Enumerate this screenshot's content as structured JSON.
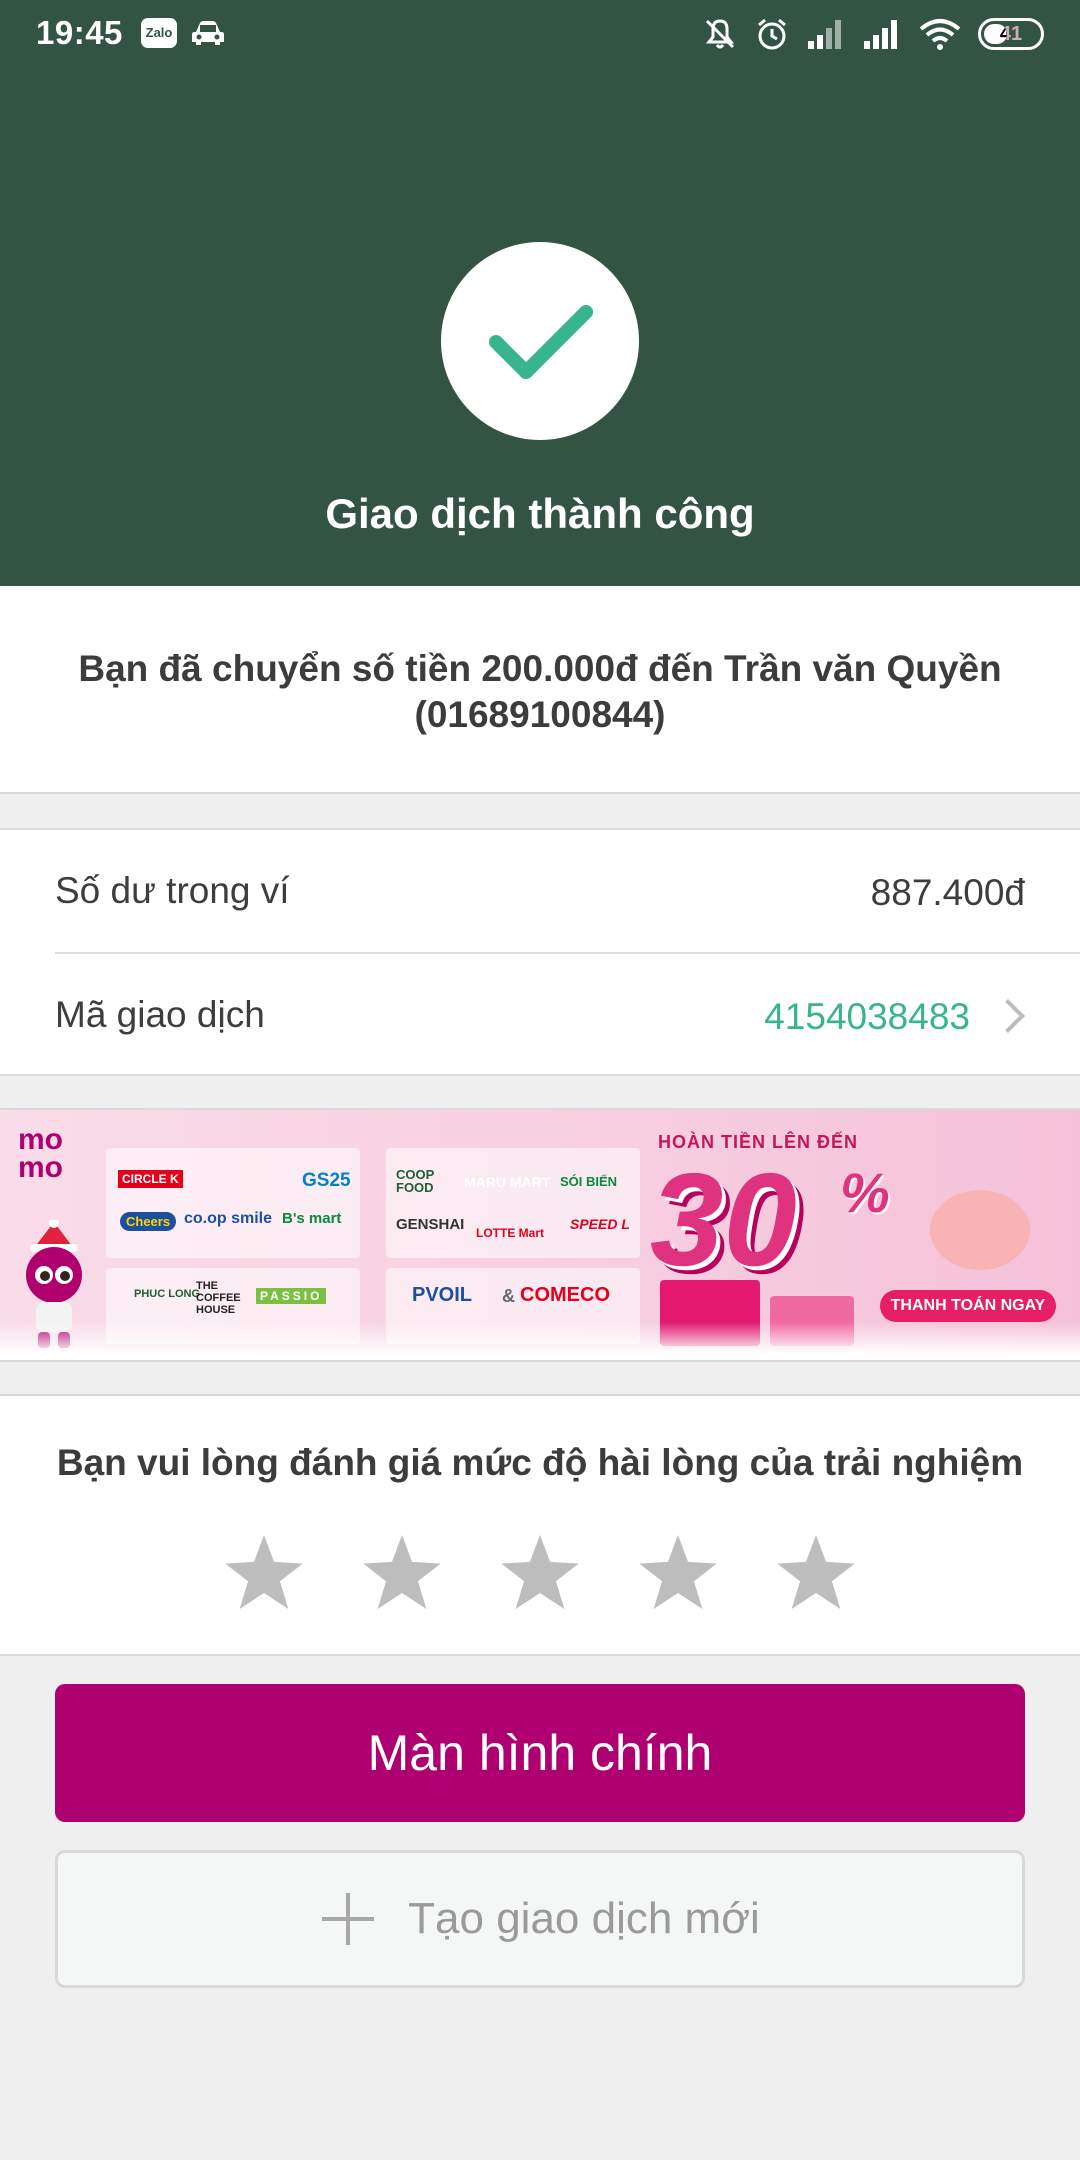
{
  "status_bar": {
    "time": "19:45",
    "zalo_label": "Zalo",
    "battery": "41",
    "icons": [
      "zalo-icon",
      "car-icon",
      "mute-icon",
      "alarm-icon",
      "signal-icon",
      "signal-icon",
      "wifi-icon",
      "battery-icon"
    ]
  },
  "header": {
    "title": "Giao dịch thành công",
    "icon": "checkmark-icon",
    "background": "#335442",
    "check_color": "#38b48e"
  },
  "message": {
    "text": "Bạn đã chuyển số tiền 200.000đ đến Trần văn Quyền (01689100844)"
  },
  "info": {
    "balance_label": "Số dư trong ví",
    "balance_value": "887.400đ",
    "transaction_label": "Mã giao dịch",
    "transaction_value": "4154038483"
  },
  "banner": {
    "logo": "mo mo",
    "brands_left": [
      "CIRCLE K",
      "Cheers",
      "co.op smile",
      "B's mart",
      "GS25",
      "PHUC LONG",
      "THE COFFEE HOUSE",
      "PASSIO"
    ],
    "brands_right": [
      "COOP FOOD",
      "MARU MART",
      "SÓI BIỂN",
      "GENSHAI",
      "LOTTE Mart",
      "SPEED L",
      "PVOIL",
      "COMECO"
    ],
    "kicker": "HOÀN TIỀN LÊN ĐẾN",
    "amount": "30",
    "percent": "%",
    "cta": "THANH TOÁN NGAY"
  },
  "rating": {
    "prompt": "Bạn vui lòng đánh giá mức độ hài lòng của trải nghiệm",
    "stars": 5,
    "selected": 0,
    "star_color": "#bdbdbd"
  },
  "buttons": {
    "main": "Màn hình chính",
    "new_transaction": "Tạo giao dịch mới",
    "main_color": "#ae0070"
  }
}
